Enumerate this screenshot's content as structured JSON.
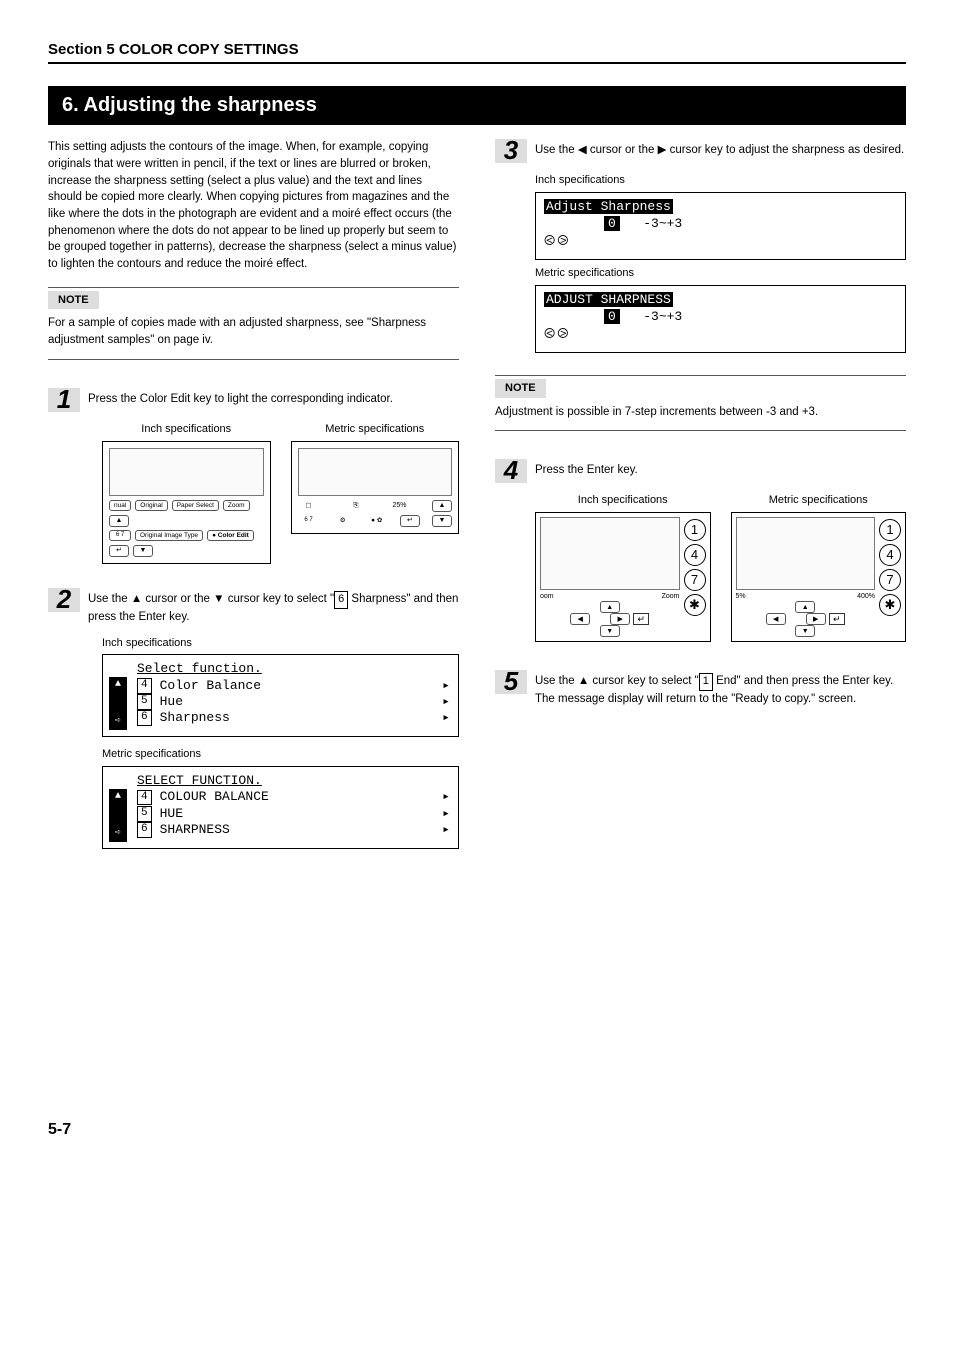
{
  "section_header": "Section 5  COLOR COPY SETTINGS",
  "title": "6.   Adjusting the sharpness",
  "intro": "This setting adjusts the contours of the image. When, for example, copying originals that were written in pencil, if the text or lines are blurred or broken, increase the sharpness setting (select a plus value) and the text and lines should be copied more clearly. When copying pictures from magazines and the like where the dots in the photograph are evident and a moiré effect occurs (the phenomenon where the dots do not appear to be lined up properly but seem to be grouped together in patterns), decrease the sharpness (select a minus value) to lighten the contours and reduce the moiré effect.",
  "note1_label": "NOTE",
  "note1_text": "For a sample of copies made with an adjusted sharpness, see \"Sharpness adjustment samples\" on page iv.",
  "step1_text": "Press the Color Edit key to light the corresponding indicator.",
  "spec_inch": "Inch specifications",
  "spec_metric": "Metric specifications",
  "panel_labels": {
    "nual": "nual",
    "original": "Original",
    "paper_select": "Paper Select",
    "zoom": "Zoom",
    "orig_img_type": "Original Image Type",
    "color_edit": "Color Edit",
    "pct": "25%"
  },
  "step2_text_a": "Use the ▲ cursor or the ▼ cursor key to select \"",
  "step2_text_b": " Sharpness\" and then press the Enter key.",
  "lcd1": {
    "header": "Select function.",
    "l4": "Color Balance",
    "l5": "Hue",
    "l6": "Sharpness"
  },
  "lcd1m": {
    "header": "SELECT FUNCTION.",
    "l4": "COLOUR BALANCE",
    "l5": "HUE",
    "l6": "SHARPNESS"
  },
  "step3_text": "Use the ◀ cursor or the ▶ cursor key to adjust the sharpness as desired.",
  "lcd3": {
    "title": "Adjust Sharpness",
    "range": "-3~+3",
    "zero": "0"
  },
  "lcd3m": {
    "title": "ADJUST SHARPNESS",
    "range": "-3~+3",
    "zero": "0"
  },
  "note2_label": "NOTE",
  "note2_text": "Adjustment is possible in 7-step increments between -3 and +3.",
  "step4_text": "Press the Enter key.",
  "keypad": {
    "zoom": "Zoom",
    "oom": "oom",
    "pct5": "5%",
    "pct400": "400%",
    "k1": "1",
    "k4": "4",
    "k7": "7",
    "star": "✱"
  },
  "step5_text_a": "Use the ▲ cursor key to select \"",
  "step5_text_b": " End\" and then press the Enter key. The message display will return to the \"Ready to copy.\" screen.",
  "num1": "1",
  "num_boxes": {
    "b4": "4",
    "b5": "5",
    "b6": "6"
  },
  "page_num": "5-7"
}
